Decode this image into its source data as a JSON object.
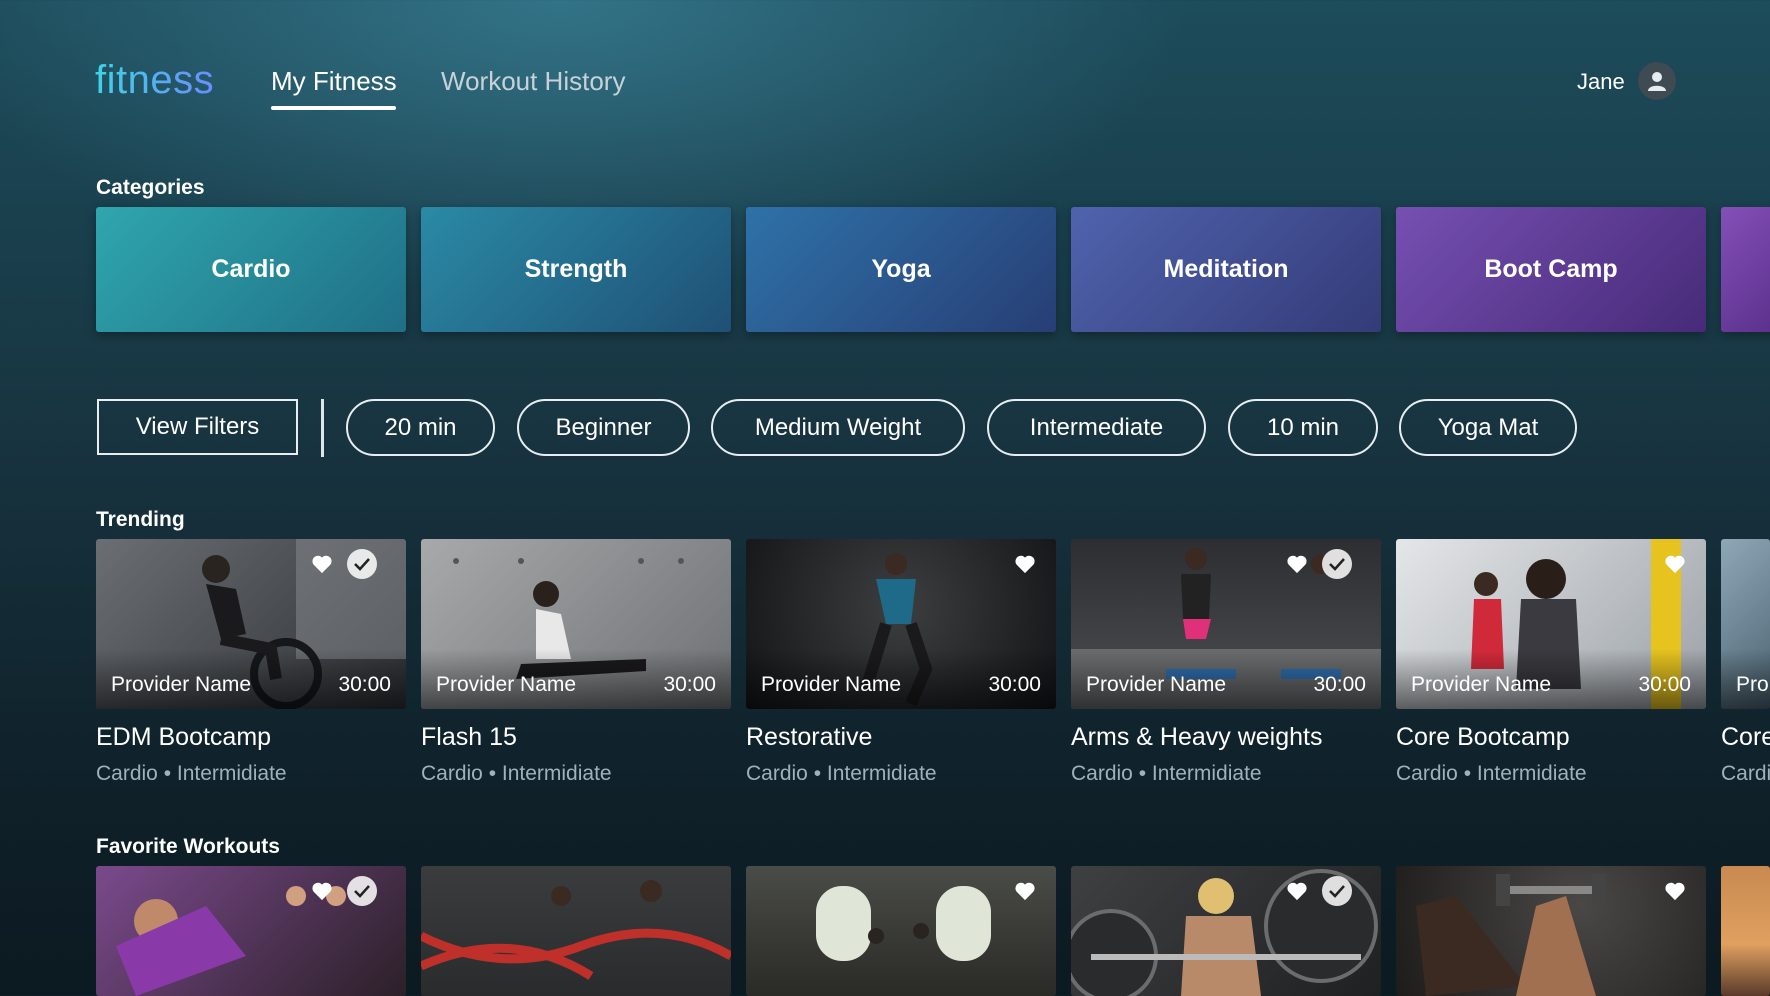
{
  "header": {
    "logo": "fitness",
    "tabs": [
      {
        "label": "My Fitness",
        "active": true
      },
      {
        "label": "Workout History",
        "active": false
      }
    ],
    "user_name": "Jane",
    "avatar_icon": "user-icon"
  },
  "categories": {
    "title": "Categories",
    "items": [
      {
        "label": "Cardio"
      },
      {
        "label": "Strength"
      },
      {
        "label": "Yoga"
      },
      {
        "label": "Meditation"
      },
      {
        "label": "Boot Camp"
      }
    ]
  },
  "filters": {
    "view_filters_label": "View Filters",
    "chips": [
      "20 min",
      "Beginner",
      "Medium Weight",
      "Intermediate",
      "10 min",
      "Yoga Mat"
    ]
  },
  "trending": {
    "title": "Trending",
    "items": [
      {
        "provider": "Provider Name",
        "duration": "30:00",
        "title": "EDM Bootcamp",
        "subtitle": "Cardio • Intermidiate",
        "favorited": true,
        "completed": true
      },
      {
        "provider": "Provider Name",
        "duration": "30:00",
        "title": "Flash 15",
        "subtitle": "Cardio • Intermidiate",
        "favorited": false,
        "completed": false
      },
      {
        "provider": "Provider Name",
        "duration": "30:00",
        "title": "Restorative",
        "subtitle": "Cardio • Intermidiate",
        "favorited": true,
        "completed": false
      },
      {
        "provider": "Provider Name",
        "duration": "30:00",
        "title": "Arms & Heavy weights",
        "subtitle": "Cardio • Intermidiate",
        "favorited": true,
        "completed": true
      },
      {
        "provider": "Provider Name",
        "duration": "30:00",
        "title": "Core Bootcamp",
        "subtitle": "Cardio • Intermidiate",
        "favorited": true,
        "completed": false
      },
      {
        "provider": "Pro",
        "title": "Core",
        "subtitle": "Cardi"
      }
    ]
  },
  "favorites": {
    "title": "Favorite Workouts",
    "items": [
      {
        "favorited": true,
        "completed": true
      },
      {
        "favorited": false,
        "completed": false
      },
      {
        "favorited": true,
        "completed": false
      },
      {
        "favorited": true,
        "completed": true
      },
      {
        "favorited": true,
        "completed": false
      }
    ]
  },
  "colors": {
    "cardio": "#2a9aa6",
    "strength": "#2a7f9c",
    "yoga": "#2e6a9e",
    "meditation": "#4a5aa0",
    "boot_camp": "#6a44a0"
  }
}
